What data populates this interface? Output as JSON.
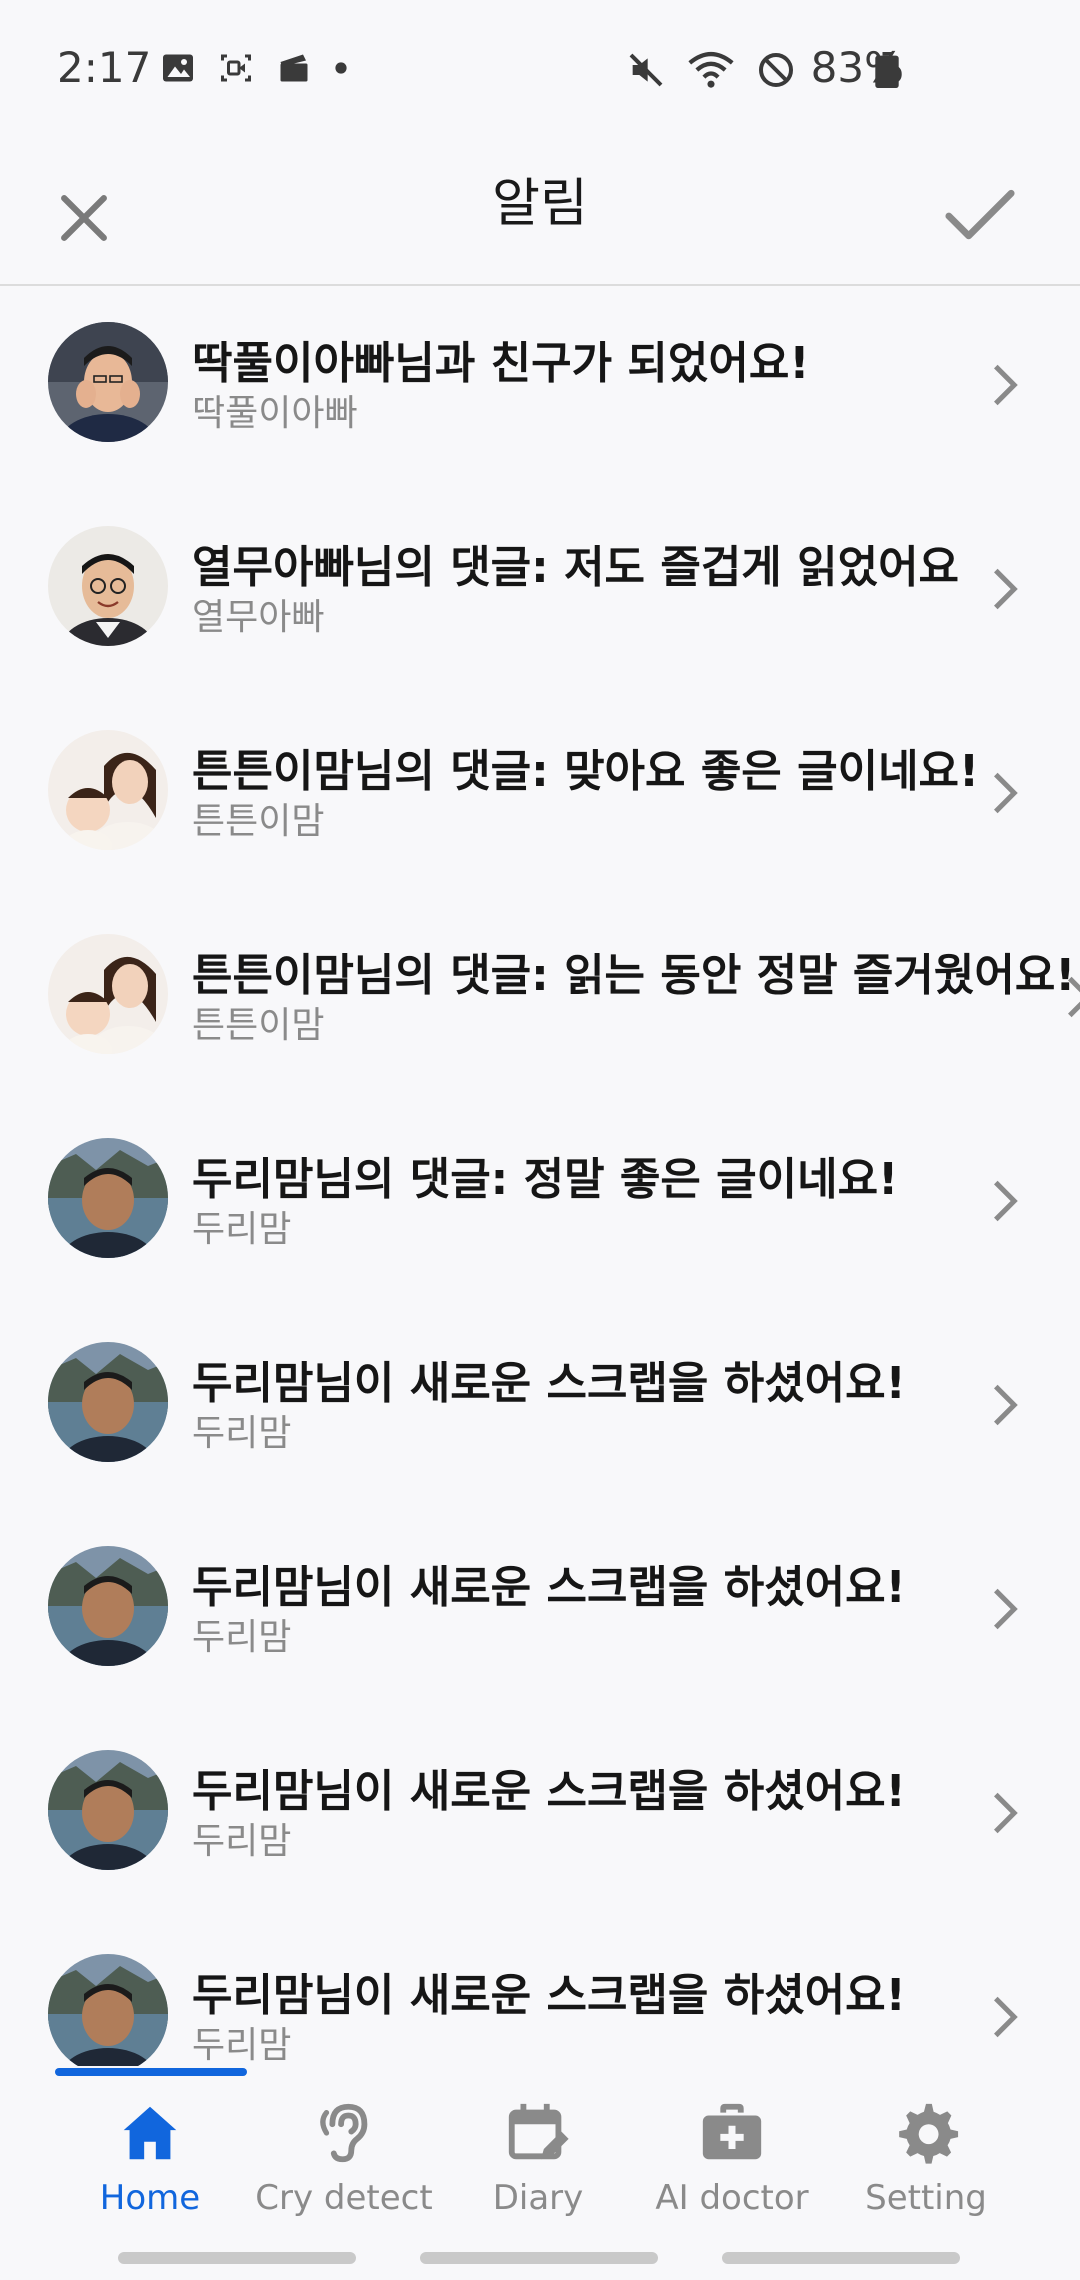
{
  "status_bar": {
    "time": "2:17",
    "battery": "83%"
  },
  "header": {
    "title": "알림",
    "close_icon": "close-icon",
    "confirm_icon": "check-icon"
  },
  "notifications": [
    {
      "title": "딱풀이아빠님과 친구가 되었어요!",
      "subtitle": "딱풀이아빠",
      "avatar": "man-hands-face"
    },
    {
      "title": "열무아빠님의 댓글: 저도 즐겁게 읽었어요",
      "subtitle": "열무아빠",
      "avatar": "man-glasses"
    },
    {
      "title": "튼튼이맘님의 댓글: 맞아요 좋은 글이네요!",
      "subtitle": "튼튼이맘",
      "avatar": "mother-baby"
    },
    {
      "title": "튼튼이맘님의 댓글: 읽는 동안 정말 즐거웠어요!",
      "subtitle": "튼튼이맘",
      "avatar": "mother-baby"
    },
    {
      "title": "두리맘님의 댓글: 정말 좋은 글이네요!",
      "subtitle": "두리맘",
      "avatar": "man-cliffs"
    },
    {
      "title": "두리맘님이 새로운 스크랩을 하셨어요!",
      "subtitle": "두리맘",
      "avatar": "man-cliffs"
    },
    {
      "title": "두리맘님이 새로운 스크랩을 하셨어요!",
      "subtitle": "두리맘",
      "avatar": "man-cliffs"
    },
    {
      "title": "두리맘님이 새로운 스크랩을 하셨어요!",
      "subtitle": "두리맘",
      "avatar": "man-cliffs"
    },
    {
      "title": "두리맘님이 새로운 스크랩을 하셨어요!",
      "subtitle": "두리맘",
      "avatar": "man-cliffs"
    }
  ],
  "bottom_nav": {
    "items": [
      {
        "label": "Home",
        "icon": "home-icon",
        "active": true
      },
      {
        "label": "Cry detect",
        "icon": "ear-icon",
        "active": false
      },
      {
        "label": "Diary",
        "icon": "calendar-edit-icon",
        "active": false
      },
      {
        "label": "AI doctor",
        "icon": "medical-kit-icon",
        "active": false
      },
      {
        "label": "Setting",
        "icon": "gear-icon",
        "active": false
      }
    ]
  },
  "colors": {
    "accent": "#1166dd",
    "background": "#f8f8fa",
    "title_text": "#161616",
    "subtitle_text": "#8a8a8a",
    "inactive_nav": "#8a8a8a"
  }
}
